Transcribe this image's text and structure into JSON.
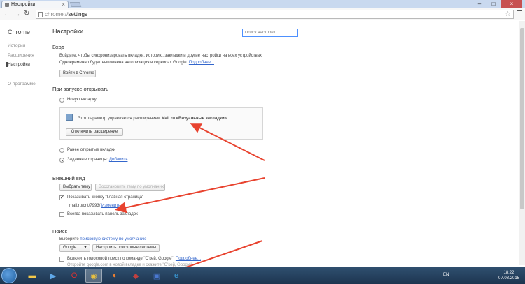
{
  "browser": {
    "tab_title": "Настройки",
    "url_scheme": "chrome://",
    "url_path": "settings"
  },
  "sidebar": {
    "title": "Chrome",
    "items": [
      {
        "label": "История"
      },
      {
        "label": "Расширения"
      },
      {
        "label": "Настройки"
      },
      {
        "label": "О программе"
      }
    ]
  },
  "main": {
    "title": "Настройки",
    "search_placeholder": "Поиск настроек",
    "signin": {
      "heading": "Вход",
      "line1": "Войдите, чтобы синхронизировать вкладки, историю, закладки и другие настройки на всех устройствах.",
      "line2": "Одновременно будет выполнена авторизация в сервисах Google.",
      "line2_link": "Подробнее...",
      "button": "Войти в Chrome"
    },
    "startup": {
      "heading": "При запуске открывать",
      "option_new_tab": "Новую вкладку",
      "ext_text_prefix": "Этот параметр управляется расширением",
      "ext_text_bold": "Mail.ru «Визуальные закладки».",
      "ext_button": "Отключить расширение",
      "option_previous": "Ранее открытые вкладки",
      "option_pages": "Заданные страницы:",
      "option_pages_link": "Добавить"
    },
    "appearance": {
      "heading": "Внешний вид",
      "choose_theme": "Выбрать тему",
      "reset_theme": "Восстановить тему по умолчанию",
      "show_home": "Показывать кнопку \"Главная страница\"",
      "home_url": "mail.ru/cnt/7993/",
      "home_change": "Изменить",
      "show_bookmarks": "Всегда показывать панель закладок"
    },
    "search": {
      "heading": "Поиск",
      "desc_prefix": "Выберите",
      "desc_link": "поисковую систему по умолчанию",
      "engine": "Google",
      "manage": "Настроить поисковые системы...",
      "voice": "Включить голосовой поиск по команде \"О'кей, Google\".",
      "voice_link": "Подробнее...",
      "voice_hint": "Откройте google.com в новой вкладке и скажите \"О'кей, Google\"."
    }
  },
  "taskbar": {
    "lang": "EN",
    "time": "18:22",
    "date": "07.08.2015"
  },
  "colors": {
    "link": "#3366cc",
    "arrow": "#e8432f",
    "focus": "#4d90fe"
  }
}
